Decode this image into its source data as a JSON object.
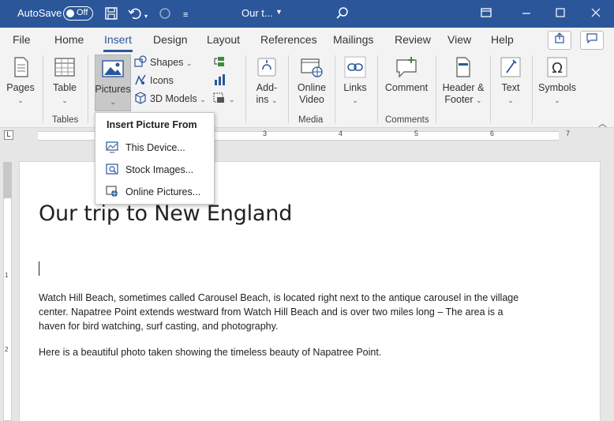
{
  "titlebar": {
    "autosave_label": "AutoSave",
    "autosave_state": "Off",
    "doc_title": "Our t...",
    "icons": [
      "save-icon",
      "undo-icon",
      "redo-icon",
      "customize-icon",
      "search-icon",
      "ribbon-display-icon",
      "minimize-icon",
      "maximize-icon",
      "close-icon"
    ]
  },
  "tabs": [
    {
      "label": "File"
    },
    {
      "label": "Home"
    },
    {
      "label": "Insert"
    },
    {
      "label": "Design"
    },
    {
      "label": "Layout"
    },
    {
      "label": "References"
    },
    {
      "label": "Mailings"
    },
    {
      "label": "Review"
    },
    {
      "label": "View"
    },
    {
      "label": "Help"
    }
  ],
  "active_tab": "Insert",
  "ribbon": {
    "pages": "Pages",
    "table": "Table",
    "tables_group": "Tables",
    "pictures": "Pictures",
    "shapes": "Shapes",
    "icons": "Icons",
    "models_3d": "3D Models",
    "addins_1": "Add-",
    "addins_2": "ins",
    "online_video_1": "Online",
    "online_video_2": "Video",
    "media_group": "Media",
    "links": "Links",
    "comment": "Comment",
    "comments_group": "Comments",
    "header_footer_1": "Header &",
    "header_footer_2": "Footer",
    "text": "Text",
    "symbols": "Symbols"
  },
  "ruler": {
    "numbers": [
      "3",
      "4",
      "5",
      "6",
      "7"
    ],
    "vnumbers": [
      "1",
      "2"
    ]
  },
  "menu": {
    "heading": "Insert Picture From",
    "items": [
      {
        "label": "This Device..."
      },
      {
        "label": "Stock Images..."
      },
      {
        "label": "Online Pictures..."
      }
    ]
  },
  "document": {
    "heading": "Our trip to New England",
    "para1": "Watch Hill Beach, sometimes called Carousel Beach, is located right next to the antique carousel in the village center. Napatree Point extends westward from Watch Hill Beach and is over two miles long – The area is a haven for bird watching, surf casting, and photography.",
    "para2": "Here is a beautiful photo taken showing the timeless beauty of Napatree Point."
  },
  "colors": {
    "accent": "#2b579a",
    "ribbon_bg": "#f3f3f3",
    "canvas_bg": "#e6e6e6"
  }
}
